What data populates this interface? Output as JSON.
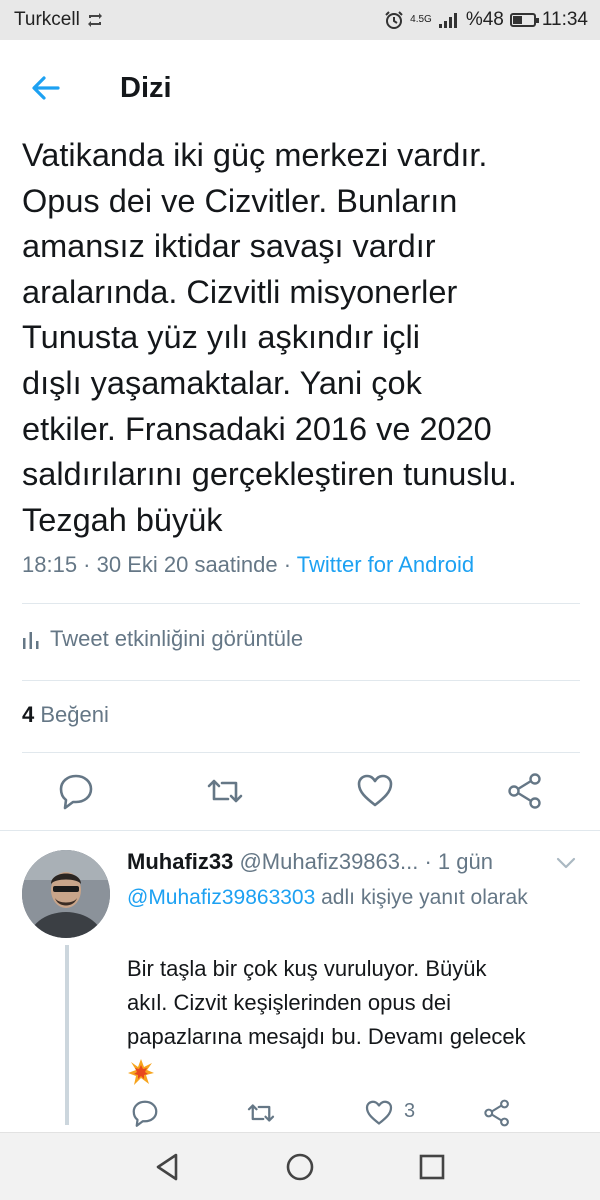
{
  "status_bar": {
    "carrier": "Turkcell",
    "network": "4.5G",
    "battery": "%48",
    "battery_level": 0.48,
    "time": "11:34"
  },
  "header": {
    "title": "Dizi",
    "back_icon": "arrow-left-icon"
  },
  "tweet": {
    "lines": [
      "Vatikanda iki güç merkezi vardır.",
      "Opus dei ve Cizvitler. Bunların",
      "amansız iktidar savaşı vardır",
      "aralarında. Cizvitli misyonerler",
      "Tunusta yüz yılı aşkındır içli",
      "dışlı yaşamaktalar. Yani çok",
      "etkiler. Fransadaki 2016 ve 2020",
      "saldırılarını gerçekleştiren tunuslu.",
      "Tezgah büyük"
    ],
    "time": "18:15 · 30 Eki 20 saatinde · ",
    "source": "Twitter for Android",
    "activity_label": "Tweet etkinliğini görüntüle",
    "likes_count": "4",
    "likes_label": " Beğeni",
    "actions": [
      "reply-icon",
      "retweet-icon",
      "like-icon",
      "share-icon"
    ]
  },
  "reply": {
    "name": "Muhafiz33",
    "handle": " @Muhafiz39863...",
    "time": " · 1 gün",
    "reply_to_handle": "@Muhafiz39863303",
    "reply_to_suffix": " adlı kişiye yanıt olarak",
    "text_lines": [
      "Bir taşla bir çok kuş vuruluyor. Büyük",
      "akıl. Cizvit keşişlerinden opus dei",
      "papazlarına mesajdı bu. Devamı gelecek"
    ],
    "emoji": "collision-emoji",
    "like_count": "3"
  },
  "colors": {
    "accent": "#1da1f2",
    "secondary_text": "#657786",
    "primary_text": "#14171a",
    "divider": "#e1e8ed"
  },
  "navbar": {
    "buttons": [
      "back-triangle-icon",
      "home-circle-icon",
      "recents-square-icon"
    ]
  }
}
